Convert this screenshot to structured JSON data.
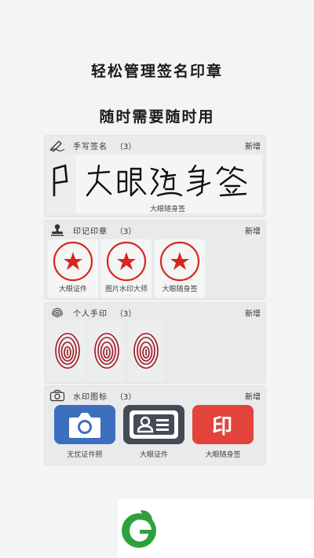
{
  "headline1": "轻松管理签名印章",
  "headline2": "随时需要随时用",
  "sections": {
    "signature": {
      "title": "手写签名",
      "count": "（3）",
      "add": "新增",
      "icon": "pen-icon",
      "item_label": "大眼随身签",
      "glyph_text": "大眼随身签"
    },
    "seal": {
      "title": "印记印章",
      "count": "（3）",
      "add": "新增",
      "icon": "stamp-icon",
      "items": [
        {
          "label": "大眼证件"
        },
        {
          "label": "图片水印大师"
        },
        {
          "label": "大眼随身签"
        }
      ]
    },
    "fingerprint": {
      "title": "个人手印",
      "count": "（3）",
      "add": "新增",
      "icon": "fingerprint-icon"
    },
    "watermark": {
      "title": "水印图标",
      "count": "（3）",
      "add": "新增",
      "icon": "camera-icon",
      "items": [
        {
          "label": "无忧证件照",
          "color": "#3e6fbe"
        },
        {
          "label": "大眼证件",
          "color": "#444b57"
        },
        {
          "label": "大眼随身签",
          "color": "#e2443b",
          "glyph": "印"
        }
      ]
    }
  },
  "colors": {
    "seal_red": "#d7261e",
    "background": "#f2f4f5",
    "brand_green": "#2fa13c"
  }
}
